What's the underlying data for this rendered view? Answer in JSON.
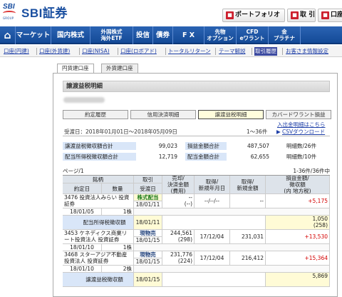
{
  "header": {
    "brand_mark": "SBI",
    "group": "GROUP",
    "brand": "SBI証券",
    "buttons": {
      "portfolio": "ポートフォリオ",
      "trade": "取 引",
      "account": "口座"
    }
  },
  "global_nav": [
    {
      "label": "⌂",
      "kind": "home"
    },
    {
      "label": "マーケット"
    },
    {
      "label": "国内株式"
    },
    {
      "label": "外国株式\n海外ETF",
      "kind": "small"
    },
    {
      "label": "投信"
    },
    {
      "label": "債券"
    },
    {
      "label": "F X"
    },
    {
      "label": "先物\nオプション",
      "kind": "small"
    },
    {
      "label": "CFD\neワラント",
      "kind": "small"
    },
    {
      "label": "金\nプラチナ",
      "kind": "small"
    }
  ],
  "sub_nav": [
    "口座(円建)",
    "口座(外貨建)",
    "口座(NISA)",
    "口座(ロボアド)",
    "トータルリターン",
    "テーマ解説",
    "取引履歴",
    "お客さま情報設定"
  ],
  "sub_nav_active": "取引履歴",
  "tabs": {
    "yen": "円貨建口座",
    "foreign": "外貨建口座"
  },
  "section_title": "譲渡益税明細",
  "sub_tabs": [
    "約定履歴",
    "信用決済明細",
    "譲渡益税明細",
    "カバードワラント損益"
  ],
  "links": {
    "warrant_fx": "入出金明細はこちら",
    "csv": "CSVダウンロード"
  },
  "period": {
    "label": "受渡日：2018年01月01日〜2018年05月09日",
    "range": "1〜36件"
  },
  "summary": [
    {
      "label": "譲渡益税徴収額合計",
      "value": "99,023",
      "label2": "損益金額合計",
      "value2": "487,507",
      "label3": "明細数/26件"
    },
    {
      "label": "配当所得税徴収額合計",
      "value": "12,719",
      "label2": "配当金額合計",
      "value2": "62,655",
      "label3": "明細数/10件"
    }
  ],
  "page": {
    "left": "ページ/1",
    "right": "1-36件/36件中"
  },
  "columns": {
    "brand": "銘柄",
    "trade_date": "約定日",
    "qty": "数量",
    "trade": "取引",
    "settle_date": "受渡日",
    "sale": "売却/\n決済金額\n(費用)",
    "acq_date": "取得/\n新規年月日",
    "acq_amount": "取得/\n新規金額",
    "pl": "損益金額/\n徴収額\n(内 地方税)"
  },
  "rows": [
    {
      "name": "3476 投資法人みらい 投資証券",
      "date": "18/01/05",
      "qty": "1株",
      "trade": "株式配当金",
      "settle": "18/01/11",
      "sale": "--\n(--)",
      "acq_date": "--/--/--",
      "acq_amount": "--",
      "pl": "+5,175",
      "pl_color": "red",
      "tax_label": "配当所得税徴収額",
      "tax_settle": "18/01/11",
      "tax_amount": "1,050\n(258)"
    },
    {
      "name": "3453 ケネディクス商業リート投資法人 投資証券",
      "date": "18/01/10",
      "qty": "1株",
      "trade": "現物売",
      "settle": "18/01/15",
      "sale": "244,561\n(298)",
      "acq_date": "17/12/04",
      "acq_amount": "231,031",
      "pl": "+13,530",
      "pl_color": "red"
    },
    {
      "name": "3468 スターアジア不動産投資法人 投資証券",
      "date": "18/01/10",
      "qty": "2株",
      "trade": "現物売",
      "settle": "18/01/15",
      "sale": "231,776\n(224)",
      "acq_date": "17/12/04",
      "acq_amount": "216,412",
      "pl": "+15,364",
      "pl_color": "red",
      "tax_label": "譲渡益税徴収額",
      "tax_settle": "18/01/15",
      "tax_amount": "5,869"
    }
  ]
}
